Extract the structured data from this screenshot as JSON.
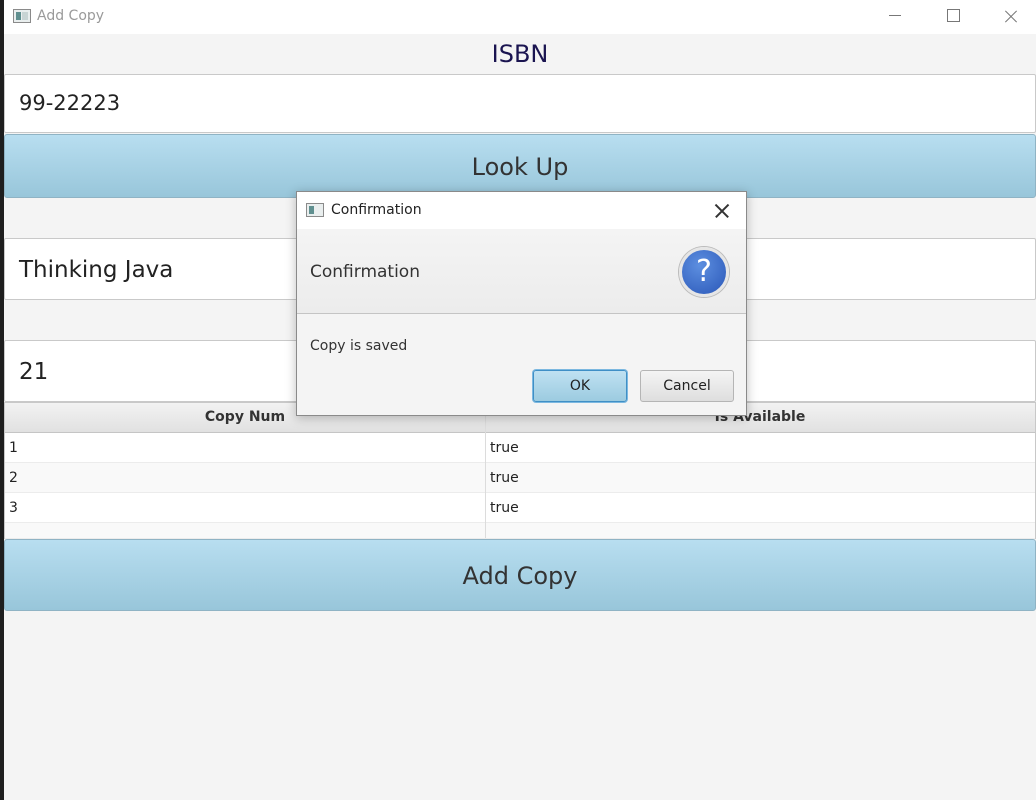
{
  "window": {
    "title": "Add Copy"
  },
  "form": {
    "isbn_label": "ISBN",
    "isbn_value": "99-22223",
    "lookup_label": "Look Up",
    "title_value": "Thinking Java",
    "number_value": "21",
    "add_copy_label": "Add Copy"
  },
  "table": {
    "columns": [
      "Copy Num",
      "Is Available"
    ],
    "rows": [
      [
        "1",
        "true"
      ],
      [
        "2",
        "true"
      ],
      [
        "3",
        "true"
      ]
    ]
  },
  "dialog": {
    "title": "Confirmation",
    "header": "Confirmation",
    "content": "Copy is saved",
    "ok_label": "OK",
    "cancel_label": "Cancel",
    "icon_glyph": "?",
    "icon": "question-icon"
  }
}
